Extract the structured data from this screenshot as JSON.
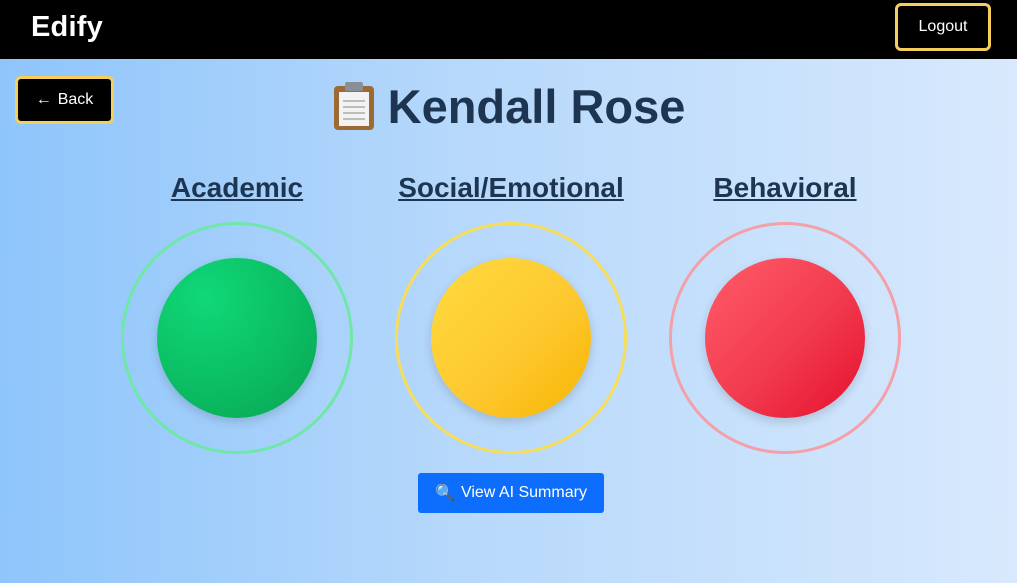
{
  "navbar": {
    "brand": "Edify",
    "logout_label": "Logout"
  },
  "back_button": {
    "arrow": "←",
    "label": "Back"
  },
  "student": {
    "icon": "clipboard-icon",
    "name": "Kendall Rose"
  },
  "categories": [
    {
      "label": "Academic",
      "status": "green",
      "ring_color": "#6ee7a8",
      "dot_color": "#0fbf66"
    },
    {
      "label": "Social/Emotional",
      "status": "yellow",
      "ring_color": "#f7dd58",
      "dot_color": "#fdc82f"
    },
    {
      "label": "Behavioral",
      "status": "red",
      "ring_color": "#f4a0a8",
      "dot_color": "#f23a4e"
    }
  ],
  "summary_button": {
    "icon": "magnifier-icon",
    "glyph": "🔍",
    "label": "View AI Summary"
  }
}
